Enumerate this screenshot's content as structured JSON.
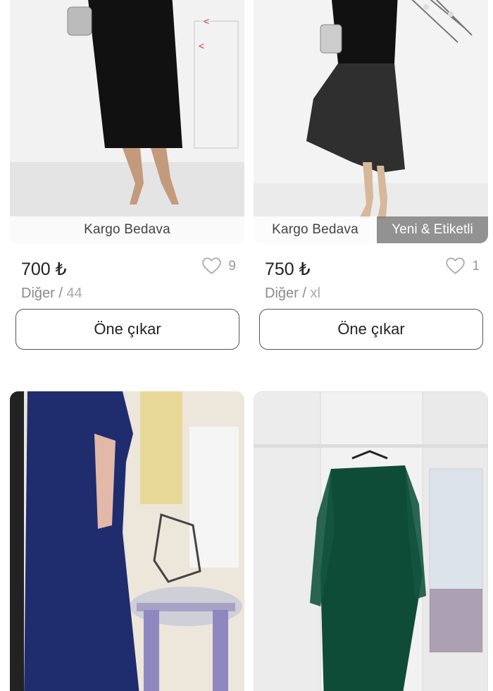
{
  "listings": [
    {
      "badge_left": "Kargo Bedava",
      "badge_right": "",
      "price": "700 ₺",
      "likes": "9",
      "brand": "Diğer",
      "separator": " / ",
      "size": "44",
      "action": "Öne çıkar"
    },
    {
      "badge_left": "Kargo Bedava",
      "badge_right": "Yeni & Etiketli",
      "price": "750 ₺",
      "likes": "1",
      "brand": "Diğer",
      "separator": " / ",
      "size": "xl",
      "action": "Öne çıkar"
    },
    {
      "photo_description": ""
    },
    {
      "photo_description": ""
    }
  ],
  "icons": {
    "like": "heart-outline-icon"
  },
  "colors": {
    "card_border": "#555555",
    "muted_text": "#8a8a8a"
  }
}
